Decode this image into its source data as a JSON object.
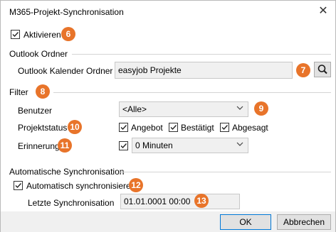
{
  "window": {
    "title": "M365-Projekt-Synchronisation",
    "close_glyph": "✕"
  },
  "activate": {
    "label": "Aktivieren",
    "checked": true,
    "badge": "6"
  },
  "outlook": {
    "section": "Outlook Ordner",
    "folder_label": "Outlook Kalender Ordner",
    "folder_value": "easyjob Projekte",
    "badge": "7"
  },
  "filter": {
    "section": "Filter",
    "badge": "8",
    "user_label": "Benutzer",
    "user_value": "<Alle>",
    "user_badge": "9",
    "status_label": "Projektstatus",
    "status_badge": "10",
    "status_options": [
      {
        "label": "Angebot",
        "checked": true
      },
      {
        "label": "Bestätigt",
        "checked": true
      },
      {
        "label": "Abgesagt",
        "checked": true
      }
    ],
    "reminder_label": "Erinnerung",
    "reminder_badge": "11",
    "reminder_checked": true,
    "reminder_value": "0 Minuten"
  },
  "autosync": {
    "section": "Automatische Synchronisation",
    "enable_label": "Automatisch synchronisieren",
    "enable_checked": true,
    "enable_badge": "12",
    "last_label": "Letzte Synchronisation",
    "last_value": "01.01.0001 00:00",
    "last_badge": "13"
  },
  "buttons": {
    "ok": "OK",
    "cancel": "Abbrechen"
  },
  "colors": {
    "badge": "#e8742a",
    "accent": "#0078d7"
  }
}
